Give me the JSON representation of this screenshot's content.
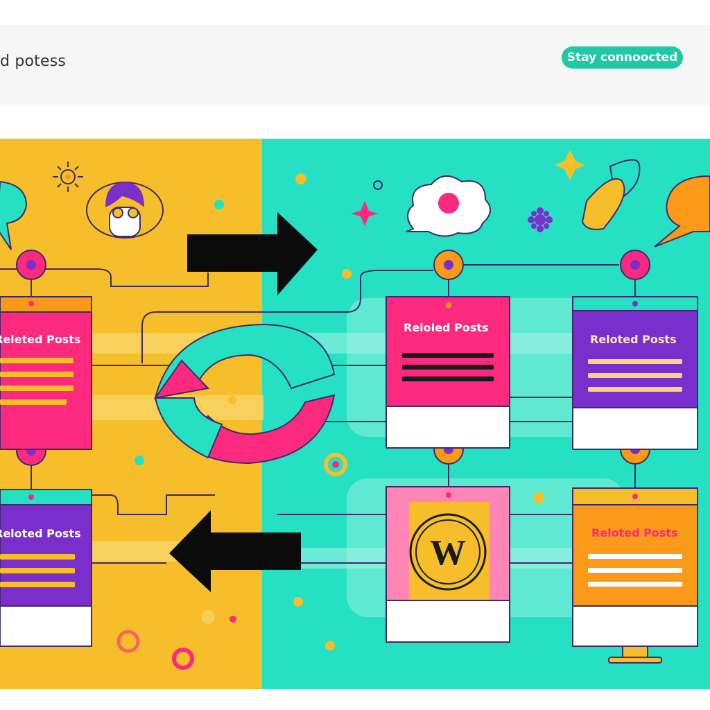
{
  "header": {
    "brand": "d potess",
    "cta_label": "Stay connoocted"
  },
  "cards": [
    {
      "title": "Releted Posts"
    },
    {
      "title": "Reloted Posts"
    },
    {
      "title": "Reloled Posts"
    },
    {
      "title": "Reloted Posts"
    },
    {
      "title": "Reloted Posts"
    }
  ],
  "colors": {
    "yellow": "#f6be2a",
    "teal": "#26e0c4",
    "pink": "#fb2a7e",
    "purple": "#7a2ecb",
    "orange": "#fb9a18",
    "green_accent": "#20c9a6"
  },
  "icons": [
    "sun-icon",
    "avatar-icon",
    "speech-bubble-icon",
    "cloud-bubble-icon",
    "sparkle-icon",
    "flower-icon",
    "leaf-icon",
    "wordpress-logo-icon",
    "arrow-right-icon",
    "arrow-left-icon",
    "cycle-arrows-icon",
    "monitor-stand-icon"
  ]
}
